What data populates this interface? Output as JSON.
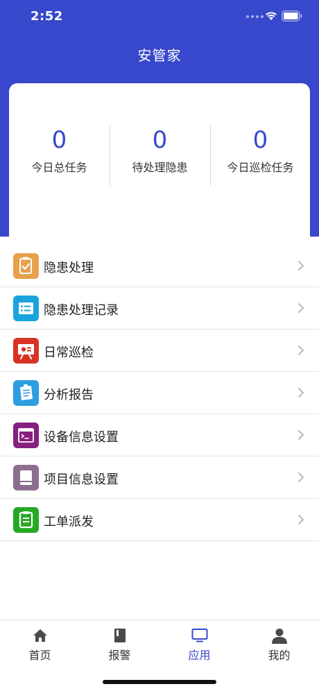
{
  "status_bar": {
    "time": "2:52",
    "wifi_icon": "wifi-icon",
    "battery_icon": "battery-icon"
  },
  "header": {
    "title": "安管家",
    "background_color": "#3748cc"
  },
  "stats": [
    {
      "value": "0",
      "label": "今日总任务"
    },
    {
      "value": "0",
      "label": "待处理隐患"
    },
    {
      "value": "0",
      "label": "今日巡检任务"
    }
  ],
  "menu": [
    {
      "label": "隐患处理",
      "icon": "clipboard-check-icon",
      "color": "#e8a04c"
    },
    {
      "label": "隐患处理记录",
      "icon": "list-icon",
      "color": "#1aa3dc"
    },
    {
      "label": "日常巡检",
      "icon": "presentation-board-icon",
      "color": "#d83224"
    },
    {
      "label": "分析报告",
      "icon": "report-icon",
      "color": "#2b9ee0"
    },
    {
      "label": "设备信息设置",
      "icon": "terminal-icon",
      "color": "#86207e"
    },
    {
      "label": "项目信息设置",
      "icon": "book-icon",
      "color": "#8c6f8e"
    },
    {
      "label": "工单派发",
      "icon": "clipboard-icon",
      "color": "#27a824"
    }
  ],
  "tab_bar": {
    "active_color": "#3748cc",
    "tabs": [
      {
        "label": "首页",
        "icon": "home-icon",
        "active": false
      },
      {
        "label": "报警",
        "icon": "book-icon",
        "active": false
      },
      {
        "label": "应用",
        "icon": "monitor-icon",
        "active": true
      },
      {
        "label": "我的",
        "icon": "user-icon",
        "active": false
      }
    ]
  }
}
